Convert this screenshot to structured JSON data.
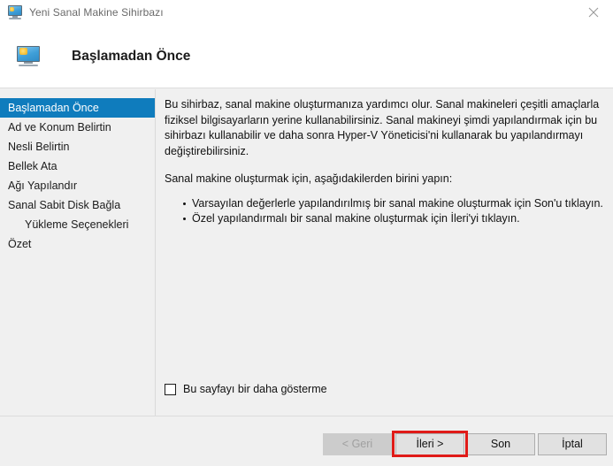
{
  "window": {
    "title": "Yeni Sanal Makine Sihirbazı",
    "title_icon": "virtual-machine-monitor-icon",
    "close_icon": "close-icon"
  },
  "header": {
    "icon": "virtual-machine-monitor-icon",
    "title": "Başlamadan Önce"
  },
  "sidebar": {
    "items": [
      {
        "label": "Başlamadan Önce",
        "selected": true,
        "sub": false
      },
      {
        "label": "Ad ve Konum Belirtin",
        "selected": false,
        "sub": false
      },
      {
        "label": "Nesli Belirtin",
        "selected": false,
        "sub": false
      },
      {
        "label": "Bellek Ata",
        "selected": false,
        "sub": false
      },
      {
        "label": "Ağı Yapılandır",
        "selected": false,
        "sub": false
      },
      {
        "label": "Sanal Sabit Disk Bağla",
        "selected": false,
        "sub": false
      },
      {
        "label": "Yükleme Seçenekleri",
        "selected": false,
        "sub": true
      },
      {
        "label": "Özet",
        "selected": false,
        "sub": false
      }
    ],
    "selected_bg": "#0f7cbd"
  },
  "content": {
    "paragraph1": "Bu sihirbaz, sanal makine oluşturmanıza yardımcı olur. Sanal makineleri çeşitli amaçlarla fiziksel bilgisayarların yerine kullanabilirsiniz. Sanal makineyi şimdi yapılandırmak için bu sihirbazı kullanabilir ve daha sonra Hyper-V Yöneticisi'ni kullanarak bu yapılandırmayı değiştirebilirsiniz.",
    "paragraph2": "Sanal makine oluşturmak için, aşağıdakilerden birini yapın:",
    "bullets": [
      "Varsayılan değerlerle yapılandırılmış bir sanal makine oluşturmak için Son'u tıklayın.",
      "Özel yapılandırmalı bir sanal makine oluşturmak için İleri'yi tıklayın."
    ],
    "checkbox": {
      "label": "Bu sayfayı bir daha gösterme",
      "checked": false
    }
  },
  "footer": {
    "buttons": [
      {
        "label": "< Geri",
        "disabled": true,
        "highlighted": false
      },
      {
        "label": "İleri >",
        "disabled": false,
        "highlighted": true
      },
      {
        "label": "Son",
        "disabled": false,
        "highlighted": false
      },
      {
        "label": "İptal",
        "disabled": false,
        "highlighted": false
      }
    ],
    "highlight_color": "#e01b18"
  }
}
